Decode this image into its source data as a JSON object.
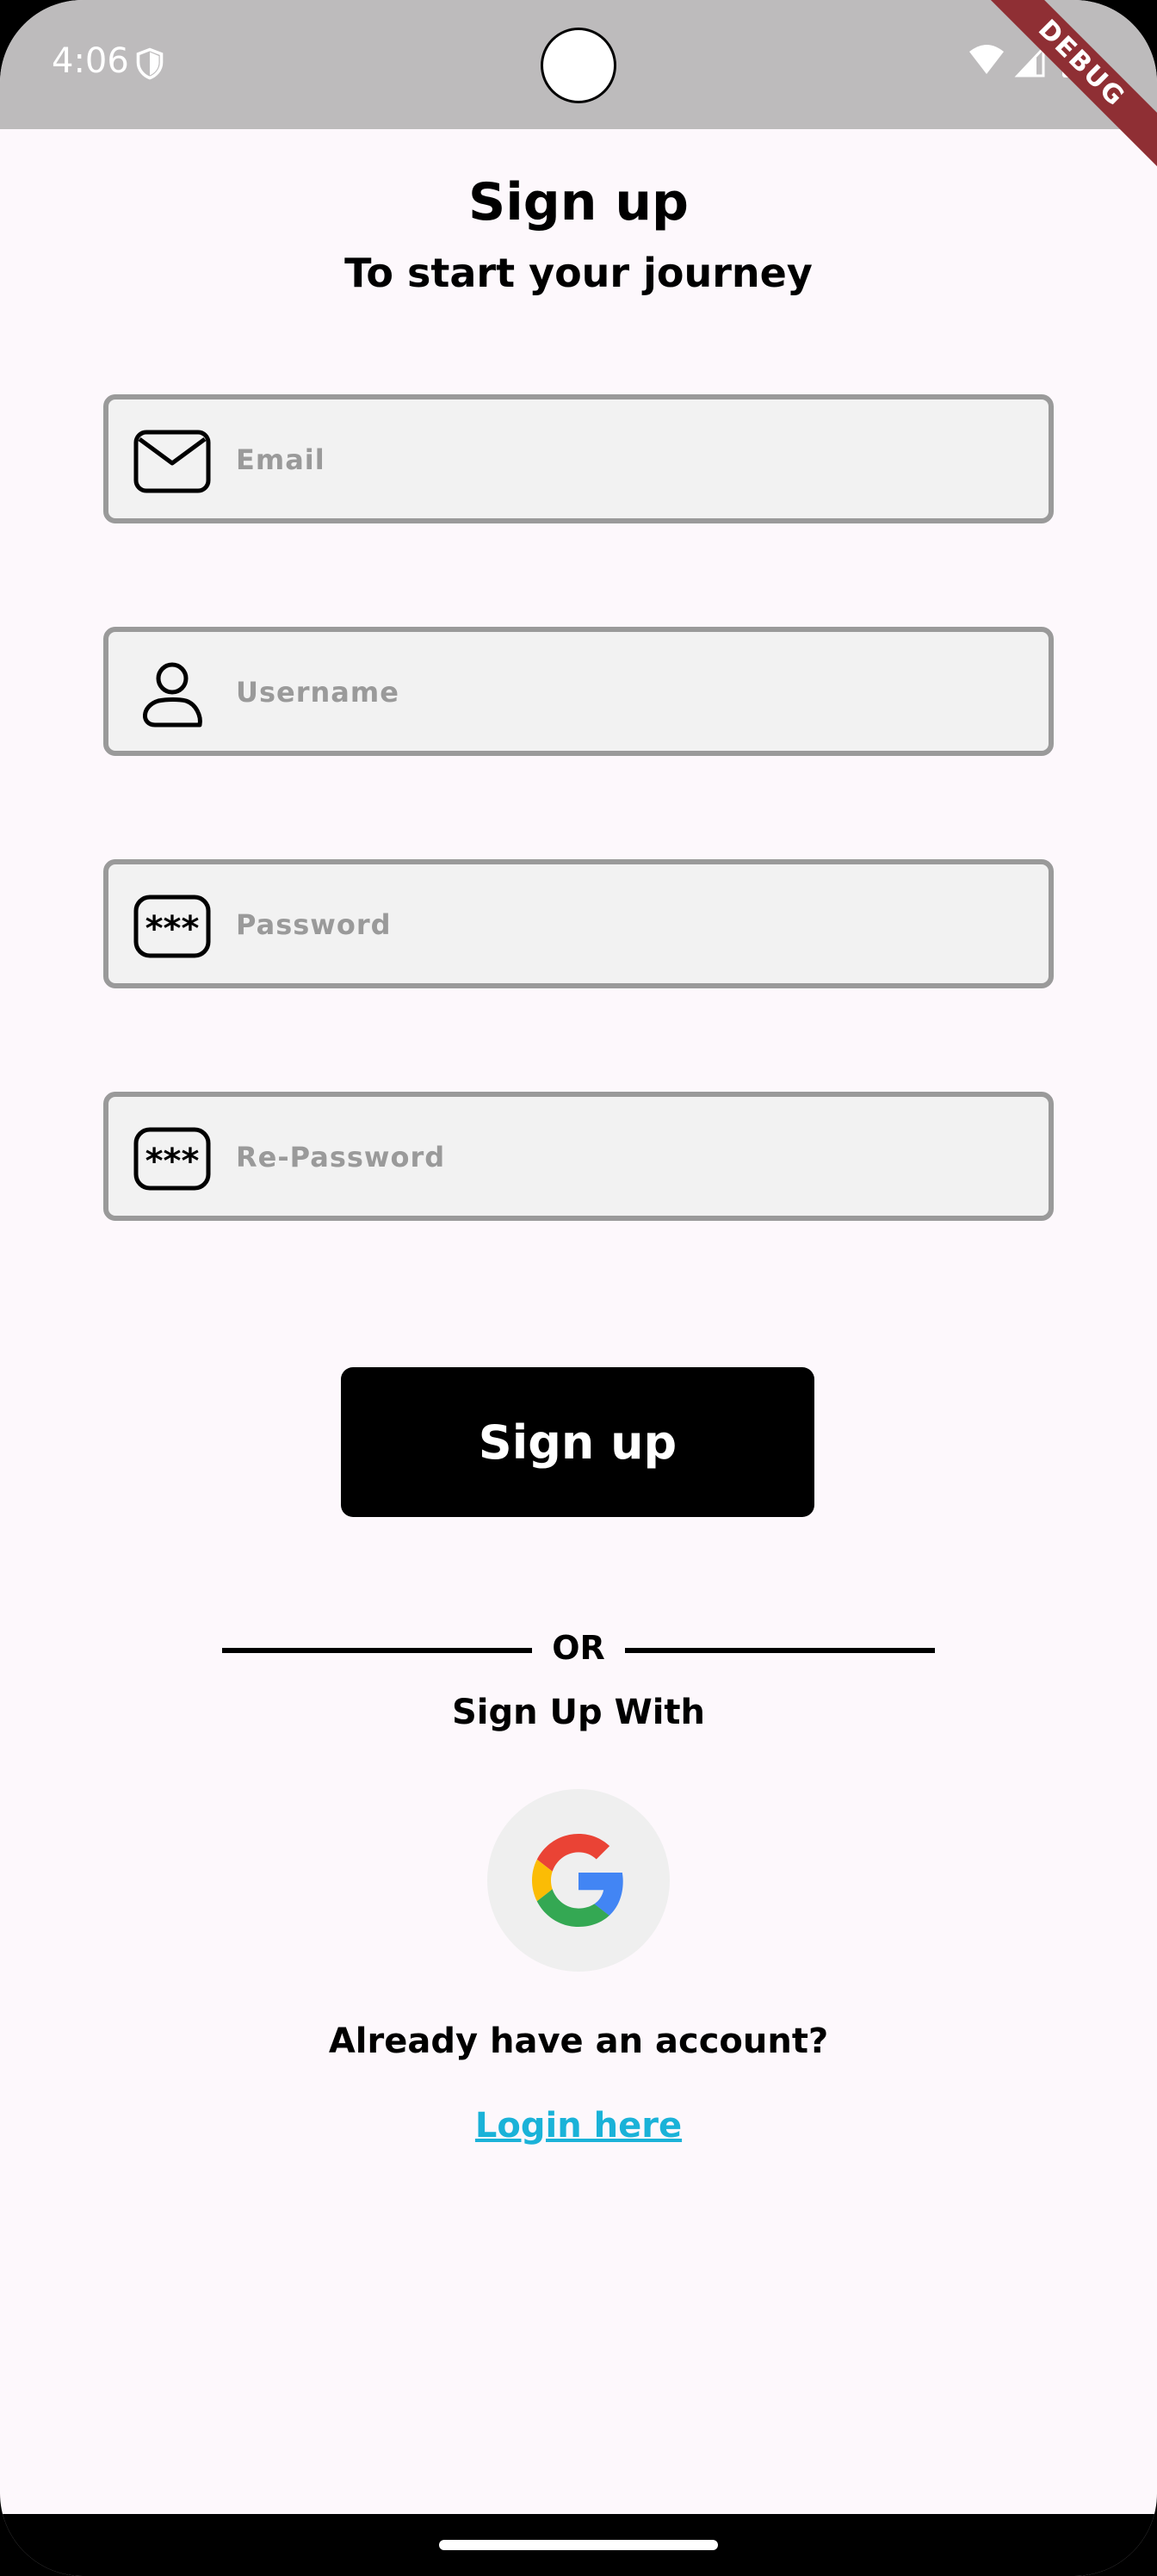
{
  "status_bar": {
    "time": "4:06",
    "debug_label": "DEBUG"
  },
  "header": {
    "title": "Sign up",
    "subtitle": "To start your journey"
  },
  "form": {
    "email": {
      "placeholder": "Email",
      "value": "",
      "icon": "envelope-icon"
    },
    "username": {
      "placeholder": "Username",
      "value": "",
      "icon": "person-icon"
    },
    "password": {
      "placeholder": "Password",
      "value": "",
      "icon": "password-icon"
    },
    "repassword": {
      "placeholder": "Re-Password",
      "value": "",
      "icon": "password-icon"
    },
    "submit_label": "Sign up"
  },
  "alt_signup": {
    "or_label": "OR",
    "with_label": "Sign Up With",
    "provider_icon": "google-icon"
  },
  "footer": {
    "already_text": "Already have an account?",
    "login_link": "Login here"
  },
  "colors": {
    "status_bar_bg": "#bdbbbc",
    "page_bg": "#fdf8fc",
    "field_bg": "#f2f2f2",
    "field_border": "#9a9a9a",
    "button_bg": "#000000",
    "link": "#1ab2d8",
    "ribbon": "#8f2f34"
  }
}
